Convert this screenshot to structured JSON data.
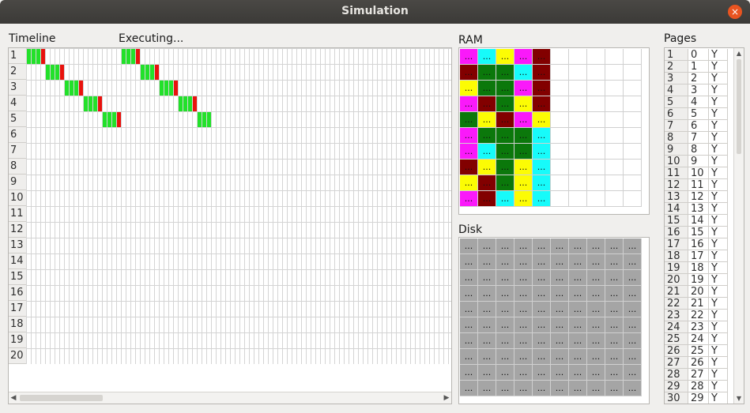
{
  "window": {
    "title": "Simulation",
    "close_label": "×"
  },
  "labels": {
    "timeline": "Timeline",
    "executing": "Executing...",
    "ram": "RAM",
    "disk": "Disk",
    "pages": "Pages"
  },
  "colors": {
    "green": "#22e12a",
    "red": "#e8120d",
    "magenta": "#fa19fa",
    "cyan": "#17fbfa",
    "yellow": "#fcfc04",
    "darkred": "#820000",
    "darkgreen": "#0b780b",
    "gray": "#a5a5a5"
  },
  "timeline": {
    "rows": [
      "1",
      "2",
      "3",
      "4",
      "5",
      "6",
      "7",
      "8",
      "9",
      "10",
      "11",
      "12",
      "13",
      "14",
      "15",
      "16",
      "17",
      "18",
      "19",
      "20"
    ],
    "bars": [
      {
        "row": 0,
        "start": 0,
        "green": 3,
        "red": 1
      },
      {
        "row": 1,
        "start": 4,
        "green": 3,
        "red": 1
      },
      {
        "row": 2,
        "start": 8,
        "green": 3,
        "red": 1
      },
      {
        "row": 3,
        "start": 12,
        "green": 3,
        "red": 1
      },
      {
        "row": 4,
        "start": 16,
        "green": 3,
        "red": 1
      },
      {
        "row": 0,
        "start": 20,
        "green": 3,
        "red": 1
      },
      {
        "row": 1,
        "start": 24,
        "green": 3,
        "red": 1
      },
      {
        "row": 2,
        "start": 28,
        "green": 3,
        "red": 1
      },
      {
        "row": 3,
        "start": 32,
        "green": 3,
        "red": 1
      },
      {
        "row": 4,
        "start": 36,
        "green": 3,
        "red": 0
      }
    ]
  },
  "ram": {
    "cell_text": "...",
    "rows": [
      [
        "magenta",
        "cyan",
        "yellow",
        "magenta",
        "darkred"
      ],
      [
        "darkred",
        "darkgreen",
        "darkgreen",
        "cyan",
        "darkred"
      ],
      [
        "yellow",
        "darkgreen",
        "darkgreen",
        "magenta",
        "darkred"
      ],
      [
        "magenta",
        "darkred",
        "darkgreen",
        "yellow",
        "darkred"
      ],
      [
        "darkgreen",
        "yellow",
        "darkred",
        "magenta",
        "yellow"
      ],
      [
        "magenta",
        "darkgreen",
        "darkgreen",
        "darkgreen",
        "cyan"
      ],
      [
        "magenta",
        "cyan",
        "darkgreen",
        "darkgreen",
        "cyan"
      ],
      [
        "darkred",
        "yellow",
        "darkgreen",
        "yellow",
        "cyan"
      ],
      [
        "yellow",
        "darkred",
        "darkgreen",
        "yellow",
        "cyan"
      ],
      [
        "magenta",
        "darkred",
        "cyan",
        "yellow",
        "cyan"
      ]
    ],
    "empty_cols": 5
  },
  "disk": {
    "cell_text": "...",
    "rows": 10,
    "cols": 10
  },
  "pages": [
    [
      "1",
      "0",
      "Y"
    ],
    [
      "2",
      "1",
      "Y"
    ],
    [
      "3",
      "2",
      "Y"
    ],
    [
      "4",
      "3",
      "Y"
    ],
    [
      "5",
      "4",
      "Y"
    ],
    [
      "6",
      "5",
      "Y"
    ],
    [
      "7",
      "6",
      "Y"
    ],
    [
      "8",
      "7",
      "Y"
    ],
    [
      "9",
      "8",
      "Y"
    ],
    [
      "10",
      "9",
      "Y"
    ],
    [
      "11",
      "10",
      "Y"
    ],
    [
      "12",
      "11",
      "Y"
    ],
    [
      "13",
      "12",
      "Y"
    ],
    [
      "14",
      "13",
      "Y"
    ],
    [
      "15",
      "14",
      "Y"
    ],
    [
      "16",
      "15",
      "Y"
    ],
    [
      "17",
      "16",
      "Y"
    ],
    [
      "18",
      "17",
      "Y"
    ],
    [
      "19",
      "18",
      "Y"
    ],
    [
      "20",
      "19",
      "Y"
    ],
    [
      "21",
      "20",
      "Y"
    ],
    [
      "22",
      "21",
      "Y"
    ],
    [
      "23",
      "22",
      "Y"
    ],
    [
      "24",
      "23",
      "Y"
    ],
    [
      "25",
      "24",
      "Y"
    ],
    [
      "26",
      "25",
      "Y"
    ],
    [
      "27",
      "26",
      "Y"
    ],
    [
      "28",
      "27",
      "Y"
    ],
    [
      "29",
      "28",
      "Y"
    ],
    [
      "30",
      "29",
      "Y"
    ]
  ]
}
